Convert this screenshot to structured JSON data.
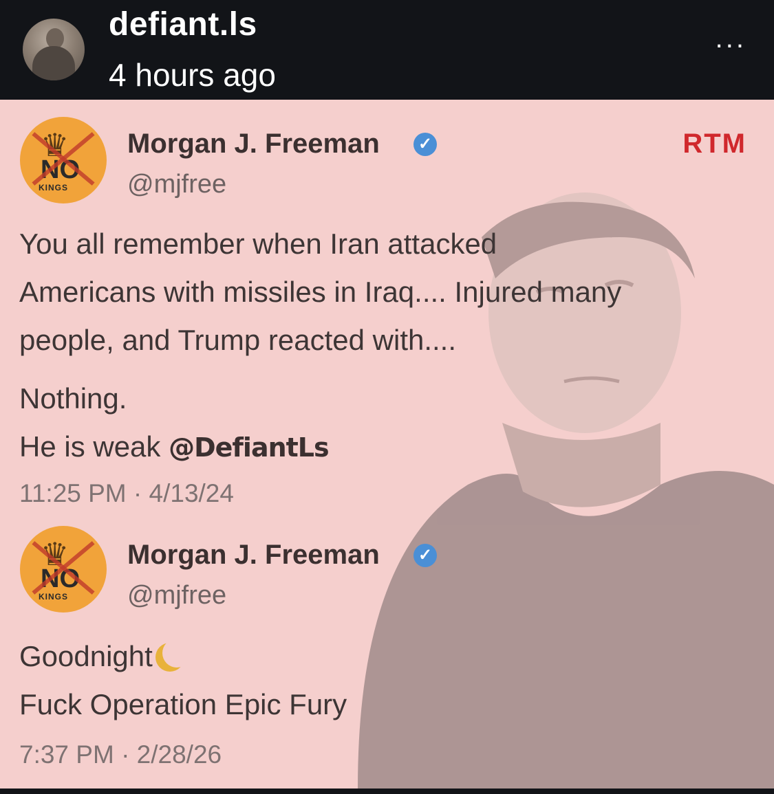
{
  "post": {
    "username": "defiant.ls",
    "time_ago": "4 hours ago",
    "more_label": "..."
  },
  "watermark": "RTM",
  "tweets": [
    {
      "name": "Morgan J. Freeman",
      "handle": "@mjfree",
      "avatar_text": {
        "top": "NO",
        "bottom": "KINGS"
      },
      "lines": [
        "You all remember when Iran attacked",
        "Americans with missiles in Iraq.... Injured many",
        "people, and Trump reacted with....",
        "Nothing.",
        "He is weak"
      ],
      "mention": "@DefiantLs",
      "timestamp": "11:25 PM · 4/13/24"
    },
    {
      "name": "Morgan J. Freeman",
      "handle": "@mjfree",
      "avatar_text": {
        "top": "NO",
        "bottom": "KINGS"
      },
      "lines": [
        "Goodnight",
        "Fuck Operation Epic Fury"
      ],
      "timestamp": "7:37 PM · 2/28/26"
    }
  ],
  "colors": {
    "header_bg": "#121418",
    "card_bg": "#f5cfcd",
    "rtm_red": "#d0282c",
    "verified_blue": "#4a8fd6",
    "logo_orange": "#f1a33a"
  },
  "icons": [
    "more-icon",
    "verified-icon",
    "moon-icon",
    "no-kings-logo"
  ]
}
